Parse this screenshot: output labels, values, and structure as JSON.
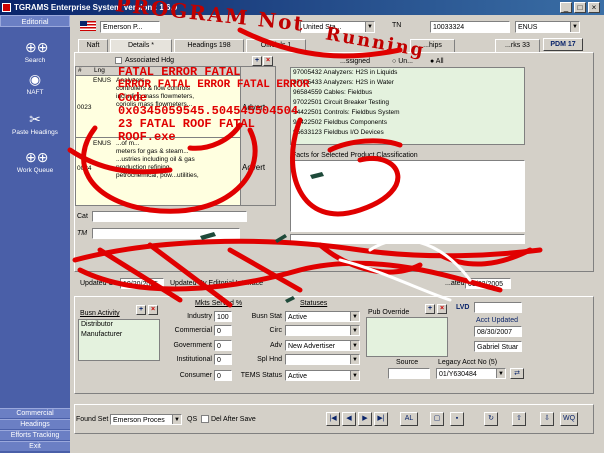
{
  "window": {
    "title": "TGRAMS Enterprise System Version : 1.6.0"
  },
  "nav": {
    "header": "Editorial",
    "items": [
      {
        "label": "Search",
        "icon": "binoculars-icon"
      },
      {
        "label": "NAFT",
        "icon": "globe-icon"
      },
      {
        "label": "Paste Headings",
        "icon": "tools-icon"
      },
      {
        "label": "Work Queue",
        "icon": "binoculars-icon"
      }
    ],
    "bottom": [
      "Commercial",
      "Headings",
      "Efforts Tracking",
      "Exit"
    ]
  },
  "top": {
    "company": "Emerson P...",
    "country": "United Sta...",
    "tn_label": "TN",
    "tn_value": "10033324",
    "lang": "ENUS",
    "pdm": "PDM 17"
  },
  "tabs": [
    {
      "label": "Naft"
    },
    {
      "label": "Details *"
    },
    {
      "label": "Headings 198"
    },
    {
      "label": "Officials 1"
    },
    {
      "label": "...hips"
    },
    {
      "label": "...rks 33"
    }
  ],
  "headings": {
    "assoc_label": "Associated Hdg",
    "col_num": "#",
    "col_lng": "Lng",
    "rows": [
      {
        "num": "0023",
        "lng": "ENUS",
        "lines": [
          "Analyzers...",
          "controllers & flow controls",
          "including mass flowmeters,",
          "coriolis mass flowmeters..."
        ]
      },
      {
        "num": "0024",
        "lng": "ENUS",
        "lines": [
          "...of m...",
          "meters for gas & steam...",
          "...ustries including oil & gas",
          "production refining,",
          "petrochemical, pow...utilities,"
        ]
      }
    ],
    "advert": "Advert",
    "assigned_label": "...ssigned",
    "un_label": "Un...",
    "all_label": "All"
  },
  "right_list": {
    "items": [
      "97005432 Analyzers: H2S in Liquids",
      "97005433 Analyzers: H2S in Water",
      "96584559 Cables: Fieldbus",
      "97022501 Circuit Breaker Testing",
      "94422501 Controls: Fieldbus System",
      "94422502 Fieldbus Components",
      "95633123 Fieldbus I/O Devices"
    ],
    "facts_label": "Facts for Selected Product Classification"
  },
  "mid": {
    "cat_label": "Cat",
    "tm_label": "TM",
    "updated_label": "Updated On",
    "updated_value": "10/20/2005",
    "updated_by": "Updated By Editorial Interface",
    "created_label": "...ated",
    "created_value": "03/22/2005"
  },
  "errors": [
    "FATAL ERROR FATAL",
    "ERROR FATAL ERROR FATAL ERROR",
    "Code",
    "0x0345059545.504545504504",
    "23 FATAL ROOF FATAL",
    "ROOF.exe"
  ],
  "scrawl": [
    "PROGRAM Not",
    "Running"
  ],
  "busn": {
    "activity_label": "Busn Activity",
    "activities": [
      "Distributor",
      "Manufacturer"
    ],
    "mkts_label": "Mkts Served %",
    "mkts": [
      {
        "label": "Industry",
        "value": "100"
      },
      {
        "label": "Commercial",
        "value": "0"
      },
      {
        "label": "Government",
        "value": "0"
      },
      {
        "label": "Institutional",
        "value": "0"
      },
      {
        "label": "Consumer",
        "value": "0"
      }
    ],
    "statuses_label": "Statuses",
    "statuses": [
      {
        "label": "Busn Stat",
        "value": "Active"
      },
      {
        "label": "Circ",
        "value": ""
      },
      {
        "label": "Adv",
        "value": "New Advertiser"
      },
      {
        "label": "Spl Hnd",
        "value": ""
      },
      {
        "label": "TEMS Status",
        "value": "Active"
      }
    ],
    "pub_override_label": "Pub Override",
    "source_label": "Source",
    "lvd_label": "LVD",
    "acct_updated_label": "Acct Updated",
    "acct_updated_value": "08/30/2007",
    "acct_user": "Gabriel Stuar",
    "legacy_label": "Legacy Acct No (5)",
    "legacy_value": "01/Y630484"
  },
  "bottom": {
    "found_set_label": "Found Set",
    "found_set_value": "Emerson Proces",
    "qs_label": "QS",
    "del_after_save": "Del After Save",
    "al_label": "AL",
    "wq_label": "WQ"
  }
}
